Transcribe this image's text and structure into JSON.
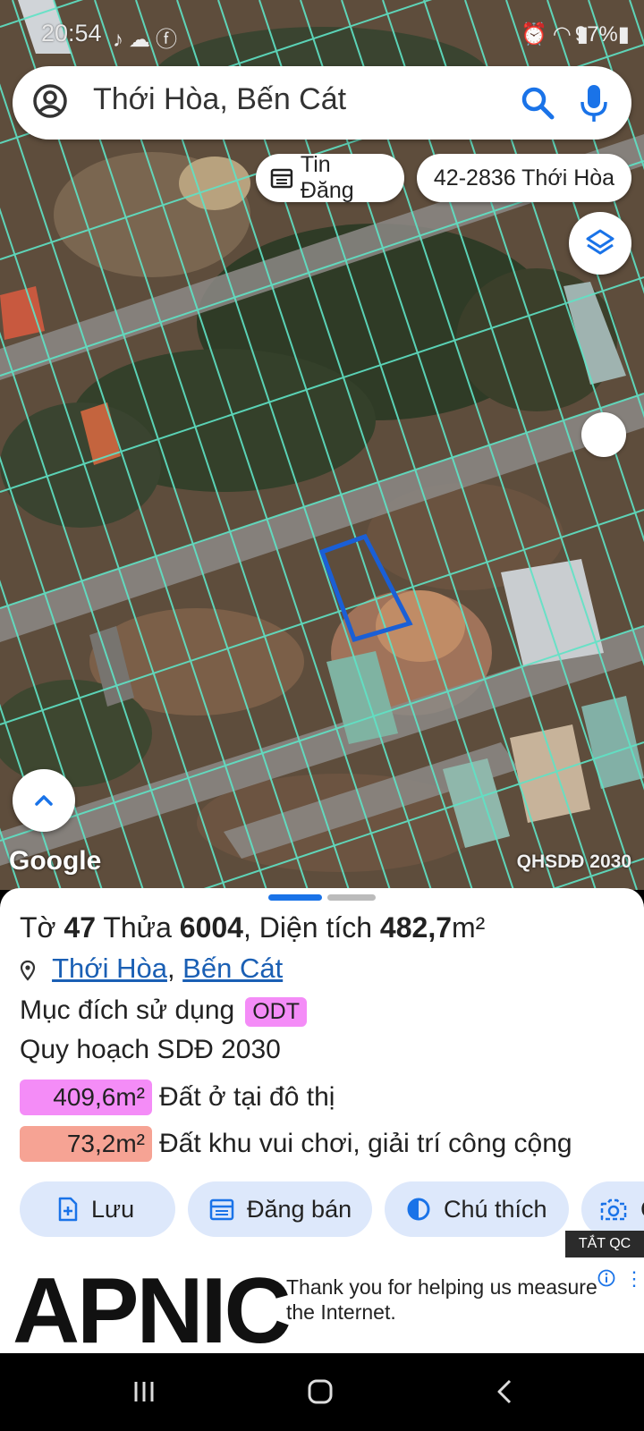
{
  "status_bar": {
    "time": "20:54",
    "left_icons": [
      "tiktok-icon",
      "cloud-icon",
      "facebook-icon"
    ],
    "right_icons": [
      "alarm-icon",
      "wifi-icon",
      "signal-icon"
    ],
    "battery": "97%"
  },
  "search": {
    "query": "Thới Hòa, Bến Cát"
  },
  "chips": {
    "listing_label": "Tin Đăng",
    "parcel_label": "42-2836 Thới Hòa"
  },
  "map": {
    "attribution": "Google",
    "overlay_label": "QHSDĐ 2030",
    "parcel_outline_color": "#1a5fd6",
    "grid_color": "#5fe3c6"
  },
  "parcel": {
    "sheet_prefix": "Tờ",
    "sheet_no": "47",
    "lot_prefix": "Thửa",
    "lot_no": "6004",
    "area_prefix": "Diện tích",
    "area_value": "482,7",
    "area_unit": "m²",
    "location_ward": "Thới Hòa",
    "location_district": "Bến Cát",
    "purpose_label": "Mục đích sử dụng",
    "purpose_code": "ODT",
    "plan_label": "Quy hoạch SDĐ 2030",
    "plan_rows": [
      {
        "amount": "409,6m²",
        "description": "Đất ở tại đô thị",
        "color": "#f48cf7"
      },
      {
        "amount": "73,2m²",
        "description": "Đất khu vui chơi, giải trí công cộng",
        "color": "#f6a394"
      }
    ]
  },
  "actions": {
    "save": "Lưu",
    "post_sale": "Đăng bán",
    "legend": "Chú thích",
    "screenshot": "C"
  },
  "ad": {
    "hide_label": "TẮT QC",
    "logo": "APNIC",
    "text": "Thank you for helping us measure the Internet."
  }
}
